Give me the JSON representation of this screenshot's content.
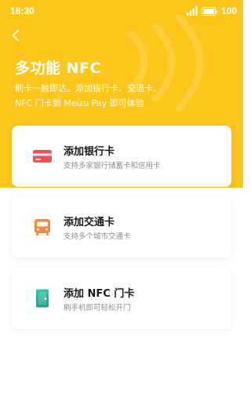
{
  "status": {
    "time": "18:30",
    "battery": "100"
  },
  "header": {
    "title": "多功能 NFC",
    "desc_line1": "刷卡一触即达。添加银行卡、交通卡、",
    "desc_line2": "NFC 门卡到 Meizu Pay 即可体验"
  },
  "cards": [
    {
      "title": "添加银行卡",
      "subtitle": "支持多家银行储蓄卡和信用卡",
      "icon": "bank-card-icon",
      "color": "#e8545a"
    },
    {
      "title": "添加交通卡",
      "subtitle": "支持多个城市交通卡",
      "icon": "bus-icon",
      "color": "#f08a3c"
    },
    {
      "title": "添加 NFC 门卡",
      "subtitle": "刷手机即可轻松开门",
      "icon": "door-icon",
      "color": "#2fb5a0"
    }
  ],
  "colors": {
    "accent": "#fdc61a"
  }
}
